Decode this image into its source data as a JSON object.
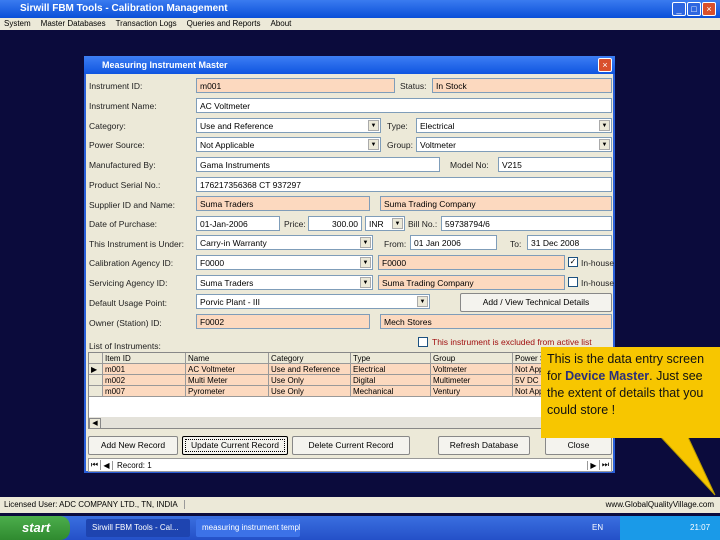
{
  "app": {
    "title": "Sirwill FBM Tools - Calibration Management",
    "menu": [
      "System",
      "Master Databases",
      "Transaction Logs",
      "Queries and Reports",
      "About"
    ]
  },
  "dialog": {
    "title": "Measuring Instrument Master",
    "fields": {
      "instrument_id": {
        "label": "Instrument ID:",
        "value": "m001"
      },
      "status": {
        "label": "Status:",
        "value": "In Stock"
      },
      "instrument_name": {
        "label": "Instrument Name:",
        "value": "AC Voltmeter"
      },
      "category": {
        "label": "Category:",
        "value": "Use and Reference"
      },
      "type": {
        "label": "Type:",
        "value": "Electrical"
      },
      "power_source": {
        "label": "Power Source:",
        "value": "Not Applicable"
      },
      "group": {
        "label": "Group:",
        "value": "Voltmeter"
      },
      "manufactured_by": {
        "label": "Manufactured By:",
        "value": "Gama Instruments"
      },
      "model_no": {
        "label": "Model No:",
        "value": "V215"
      },
      "serial_no": {
        "label": "Product Serial No.:",
        "value": "176217356368 CT 937297"
      },
      "supplier": {
        "label": "Supplier ID and Name:",
        "id": "Suma Traders",
        "name": "Suma Trading Company"
      },
      "date_of_purchase": {
        "label": "Date of Purchase:",
        "value": "01-Jan-2006"
      },
      "price": {
        "label": "Price:",
        "value": "300.00",
        "currency": "INR"
      },
      "bill_no": {
        "label": "Bill No.:",
        "value": "59738794/6"
      },
      "under": {
        "label": "This Instrument is Under:",
        "value": "Carry-in Warranty",
        "from_label": "From:",
        "from": "01 Jan 2006",
        "to_label": "To:",
        "to": "31 Dec 2008"
      },
      "calibration_agency": {
        "label": "Calibration Agency ID:",
        "id": "F0000",
        "name": "F0000",
        "inhouse_label": "In-house",
        "inhouse": true
      },
      "servicing_agency": {
        "label": "Servicing Agency ID:",
        "id": "Suma Traders",
        "name": "Suma Trading Company",
        "inhouse_label": "In-house",
        "inhouse": false
      },
      "default_usage": {
        "label": "Default Usage Point:",
        "value": "Porvic Plant - III"
      },
      "owner": {
        "label": "Owner (Station) ID:",
        "id": "F0002",
        "name": "Mech Stores"
      }
    },
    "tech_button": "Add / View Technical Details",
    "excluded_label": "This instrument is excluded from active list",
    "list_label": "List of Instruments:",
    "grid": {
      "columns": [
        "Item ID",
        "Name",
        "Category",
        "Type",
        "Group",
        "Power S"
      ],
      "rows": [
        [
          "m001",
          "AC Voltmeter",
          "Use and Reference",
          "Electrical",
          "Voltmeter",
          "Not App"
        ],
        [
          "m002",
          "Multi Meter",
          "Use Only",
          "Digital",
          "Multimeter",
          "5V DC"
        ],
        [
          "m007",
          "Pyrometer",
          "Use Only",
          "Mechanical",
          "Ventury",
          "Not App"
        ]
      ]
    },
    "buttons": {
      "add": "Add New Record",
      "update": "Update Current Record",
      "delete": "Delete Current Record",
      "refresh": "Refresh Database",
      "close": "Close"
    },
    "record": "Record: 1"
  },
  "statusbar": {
    "left": "Licensed User: ADC COMPANY LTD., TN, INDIA",
    "right": "www.GlobalQualityVillage.com"
  },
  "taskbar": {
    "start": "start",
    "tasks": [
      "Sirwill FBM Tools - Cal...",
      "measuring instrument template..."
    ],
    "lang": "EN",
    "clock": "21:07"
  },
  "callout": {
    "pre": "This is the data entry screen for ",
    "bold": "Device Master",
    "post": ". Just see the extent of details that you could store !",
    "accent": "#f7c600"
  }
}
